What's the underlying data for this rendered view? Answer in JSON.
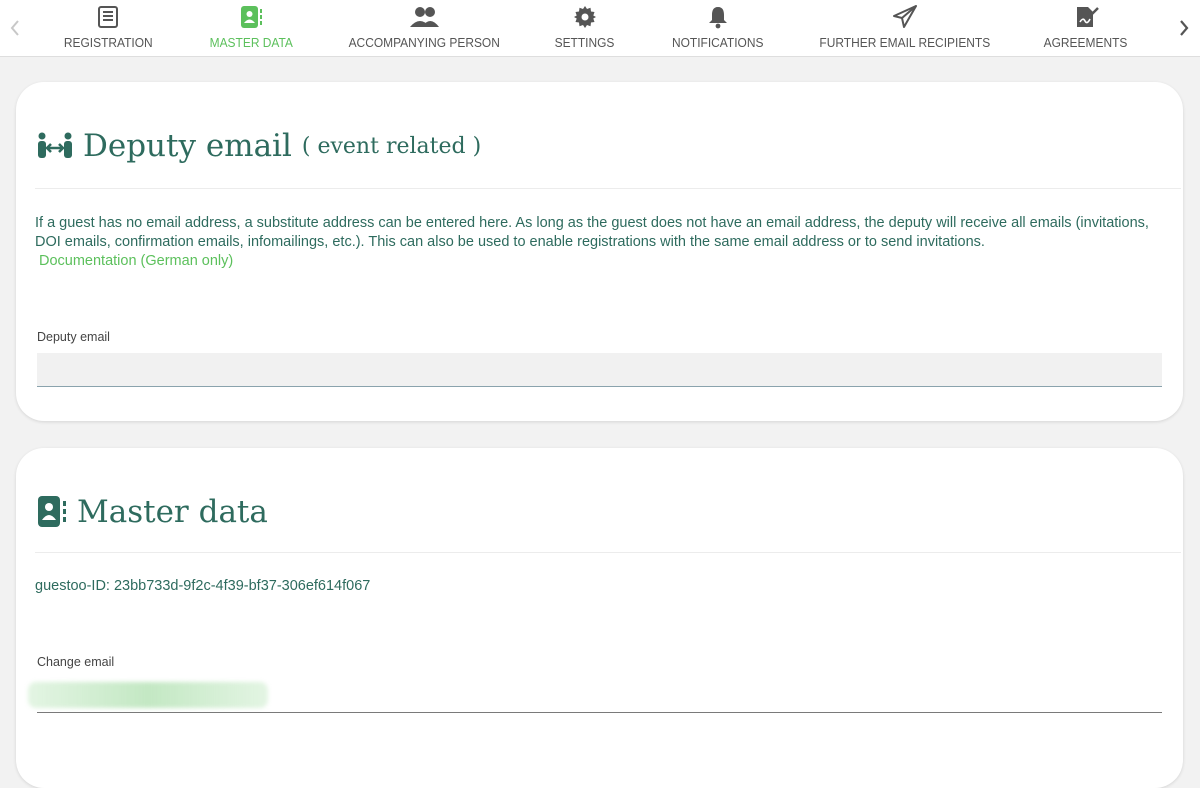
{
  "nav": {
    "tabs": [
      {
        "label": "REGISTRATION",
        "icon": "registration-icon"
      },
      {
        "label": "MASTER DATA",
        "icon": "master-data-icon",
        "active": true
      },
      {
        "label": "ACCOMPANYING PERSON",
        "icon": "users-icon"
      },
      {
        "label": "SETTINGS",
        "icon": "gear-icon"
      },
      {
        "label": "NOTIFICATIONS",
        "icon": "bell-icon"
      },
      {
        "label": "FURTHER EMAIL RECIPIENTS",
        "icon": "paper-plane-icon"
      },
      {
        "label": "AGREEMENTS",
        "icon": "signature-icon"
      }
    ],
    "active_color": "#5cc05c"
  },
  "deputy": {
    "title": "Deputy email",
    "subtitle": "( event related )",
    "description": "If a guest has no email address, a substitute address can be entered here. As long as the guest does not have an email address, the deputy will receive all emails (invitations, DOI emails, confirmation emails, infomailings, etc.). This can also be used to enable registrations with the same email address or to send invitations.",
    "doc_link": "Documentation (German only)",
    "field_label": "Deputy email",
    "field_value": ""
  },
  "master": {
    "title": "Master data",
    "guest_id_label": "guestoo-ID:",
    "guest_id_value": "23bb733d-9f2c-4f39-bf37-306ef614f067",
    "change_email_label": "Change email"
  },
  "colors": {
    "primary": "#2e6b5e",
    "accent": "#5cc05c",
    "background": "#f2f2f2"
  }
}
